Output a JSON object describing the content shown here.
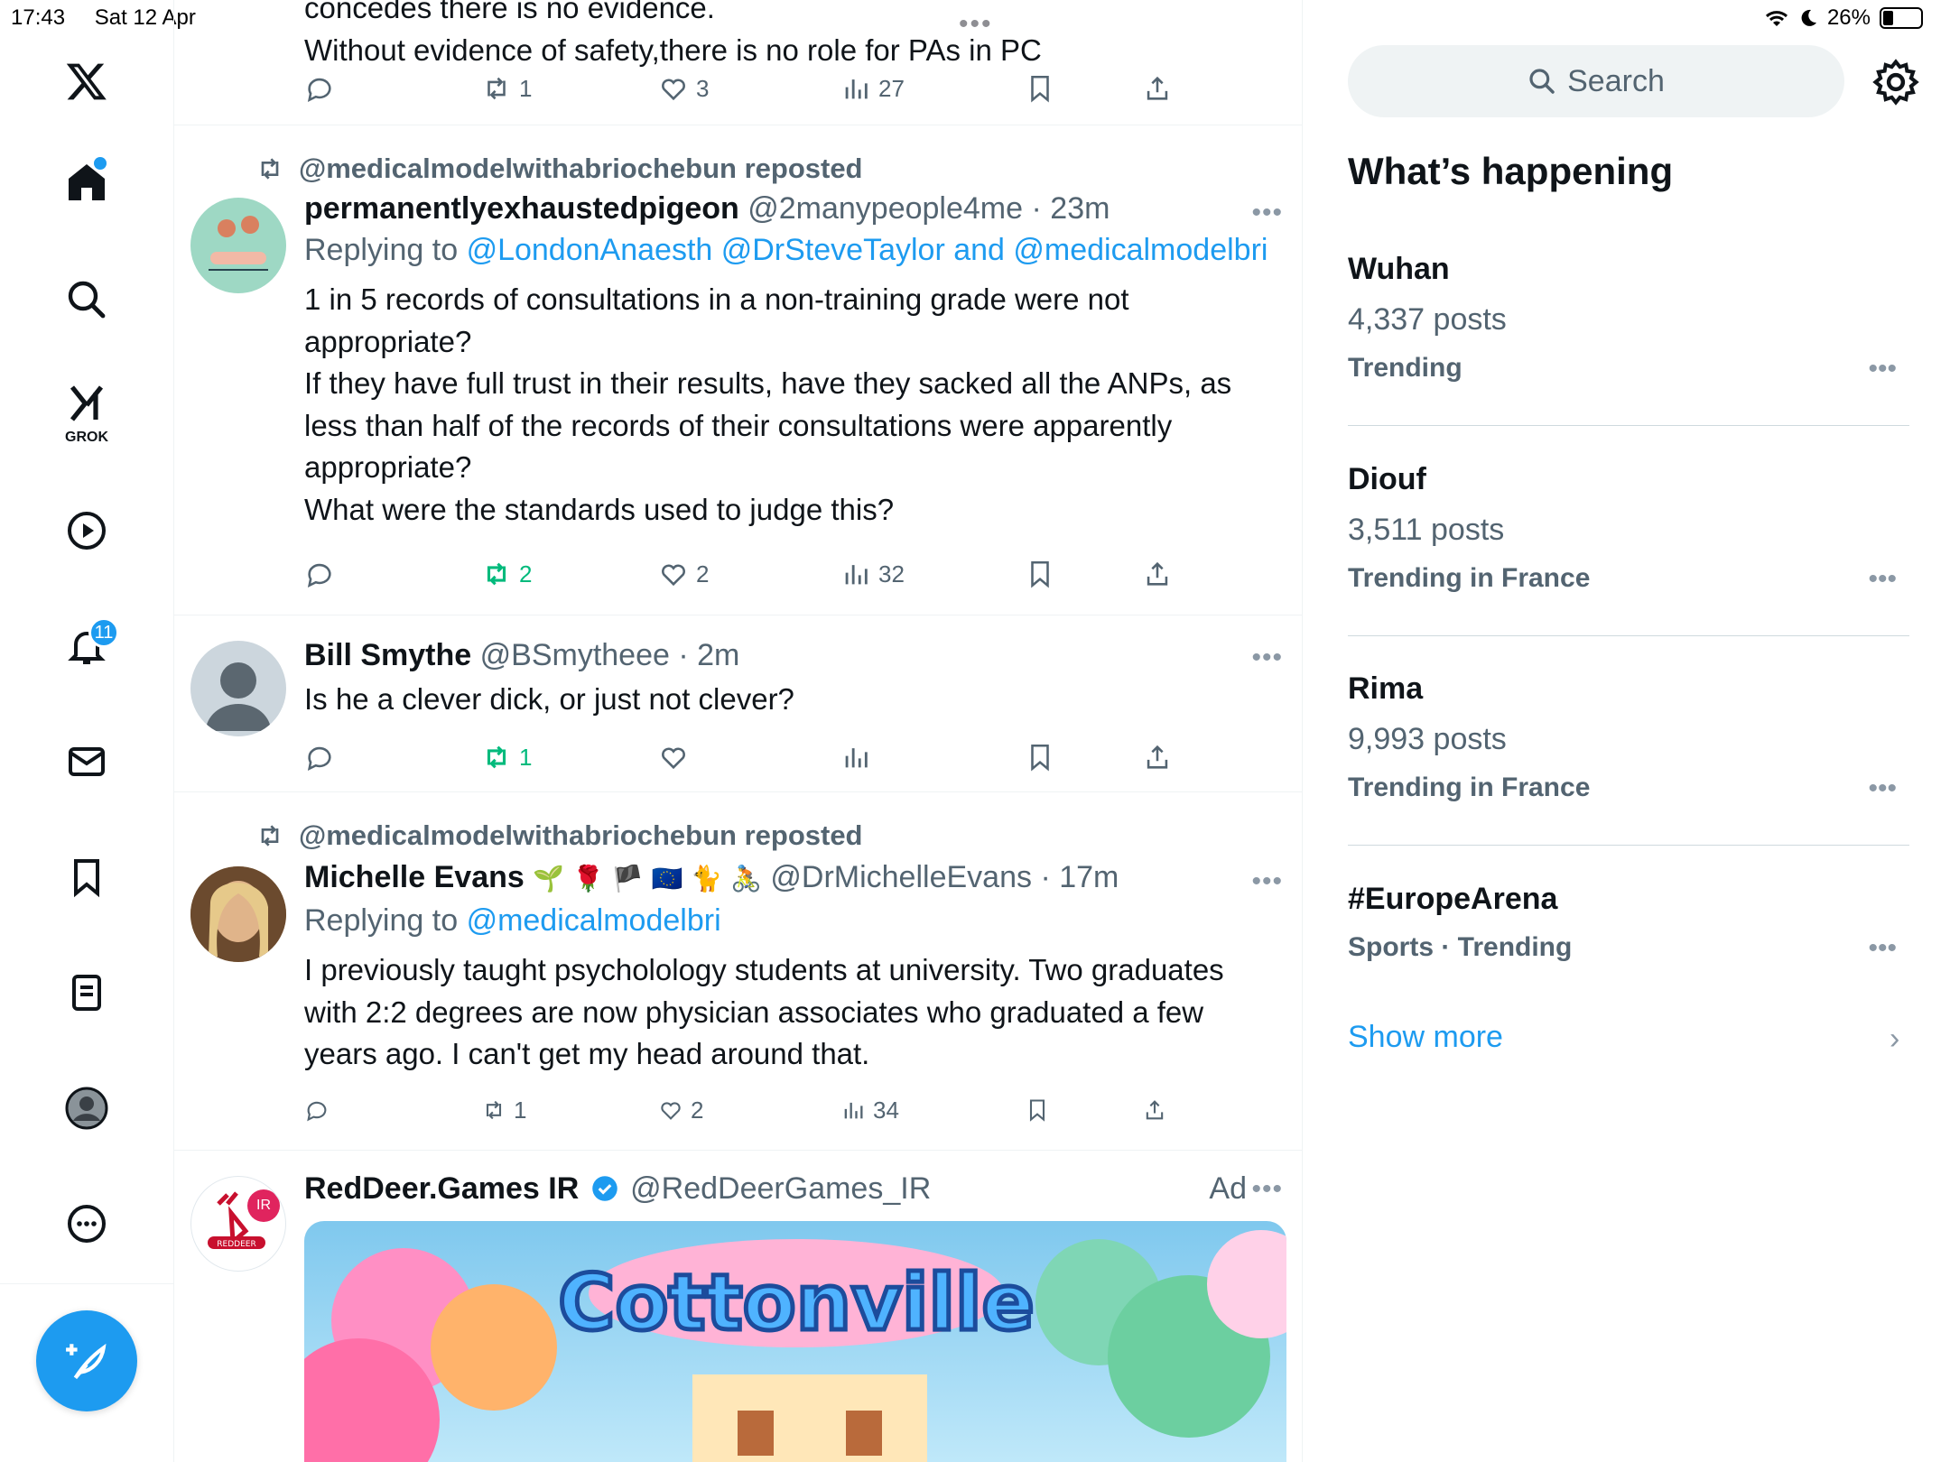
{
  "status_bar": {
    "time": "17:43",
    "date": "Sat 12 Apr",
    "battery": "26%",
    "battery_level": 0.26
  },
  "nav": {
    "notifications_badge": "11",
    "grok_label": "GROK"
  },
  "posts": [
    {
      "text_lines": [
        "concedes there is no evidence.",
        "Without evidence of safety,there is no role for PAs in PC"
      ],
      "replies": "",
      "reposts": "1",
      "likes": "3",
      "views": "27"
    },
    {
      "repost_by": "@medicalmodelwithabriochebun reposted",
      "name": "permanentlyexhaustedpigeon",
      "handle": "@2manypeople4me",
      "time": "23m",
      "replying_prefix": "Replying to",
      "replying_to": "@LondonAnaesth @DrSteveTaylor and @medicalmodelbri",
      "text_lines": [
        "1 in 5 records of consultations in a non-training grade were not",
        "appropriate?",
        "If they have full trust in their results, have they sacked all the ANPs, as",
        "less than half of the records of their consultations were apparently",
        "appropriate?",
        "What were the standards used to judge this?"
      ],
      "replies": "",
      "reposts": "2",
      "likes": "2",
      "views": "32"
    },
    {
      "name": "Bill Smythe",
      "handle": "@BSmytheee",
      "time": "2m",
      "text_lines": [
        "Is he a clever dick, or just not clever?"
      ],
      "replies": "",
      "reposts": "1",
      "likes": "",
      "views": ""
    },
    {
      "repost_by": "@medicalmodelwithabriochebun reposted",
      "name": "Michelle Evans",
      "name_emoji": "🌱 🌹 🏴 🇪🇺 🐈 🚴",
      "handle": "@DrMichelleEvans",
      "time": "17m",
      "replying_prefix": "Replying to",
      "replying_to": "@medicalmodelbri",
      "text_lines": [
        "I previously taught psycholology students at university. Two graduates",
        "with 2:2 degrees  are now physician associates who graduated a few",
        "years ago. I can't get my head around that."
      ],
      "replies": "",
      "reposts": "1",
      "likes": "2",
      "views": "34"
    },
    {
      "name": "RedDeer.Games IR",
      "handle": "@RedDeerGames_IR",
      "ad_label": "Ad",
      "avatar_text": "IR",
      "avatar_brand": "REDDEER",
      "image_title": "Cottonville"
    }
  ],
  "sidebar": {
    "search_placeholder": "Search",
    "title": "What’s happening",
    "trends": [
      {
        "name": "Wuhan",
        "posts": "4,337 posts",
        "category": "Trending"
      },
      {
        "name": "Diouf",
        "posts": "3,511 posts",
        "category": "Trending in France"
      },
      {
        "name": "Rima",
        "posts": "9,993 posts",
        "category": "Trending in France"
      },
      {
        "name": "#EuropeArena",
        "posts": "",
        "category": "Sports · Trending"
      }
    ],
    "show_more": "Show more"
  },
  "colors": {
    "accent": "#1d9bf0",
    "repost_green": "#00ba7c",
    "secondary_text": "#536471"
  }
}
